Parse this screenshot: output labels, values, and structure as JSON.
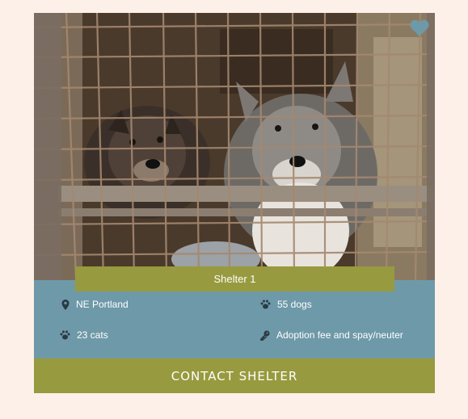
{
  "card": {
    "shelter_name": "Shelter 1",
    "location": "NE Portland",
    "dogs": "55 dogs",
    "cats": "23 cats",
    "policy": "Adoption fee and spay/neuter",
    "contact_button": "CONTACT SHELTER"
  },
  "icons": {
    "favorite": "heart-icon",
    "location": "map-pin-icon",
    "dogs": "paw-icon",
    "cats": "paw-icon",
    "policy": "key-icon"
  },
  "colors": {
    "page_bg": "#fdf0e8",
    "info_bg": "#6e99a8",
    "accent": "#979a3e",
    "heart": "#6e99a8"
  }
}
